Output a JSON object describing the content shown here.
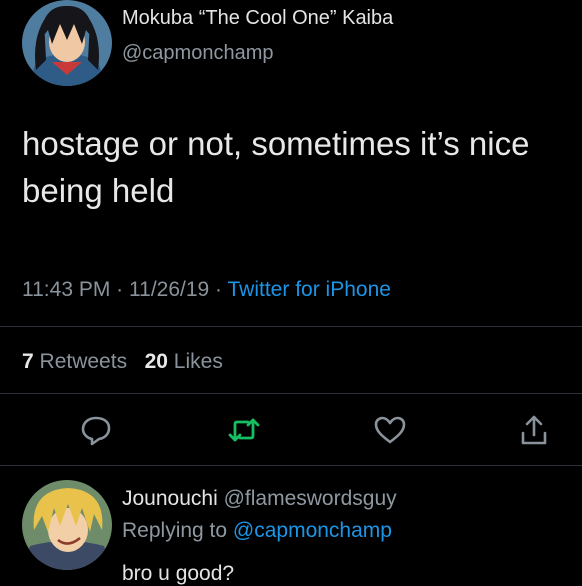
{
  "tweet": {
    "author_name": "Mokuba “The Cool One” Kaiba",
    "author_handle": "@capmonchamp",
    "text": "hostage or not, sometimes it’s nice being held",
    "time": "11:43 PM",
    "date": "11/26/19",
    "separator": "·",
    "source": "Twitter for iPhone",
    "retweets_count": "7",
    "retweets_label": "Retweets",
    "likes_count": "20",
    "likes_label": "Likes"
  },
  "actions": [
    {
      "icon": "reply-icon"
    },
    {
      "icon": "retweet-icon"
    },
    {
      "icon": "like-icon"
    },
    {
      "icon": "share-icon"
    }
  ],
  "reply": {
    "author_name": "Jounouchi",
    "author_handle": "@flameswordsguy",
    "replying_prefix": "Replying to",
    "replying_to": "@capmonchamp",
    "text": "bro u good?"
  },
  "colors": {
    "background": "#000000",
    "link": "#1c95e6",
    "retweet_icon": "#17bf63",
    "muted": "#8a939b"
  }
}
